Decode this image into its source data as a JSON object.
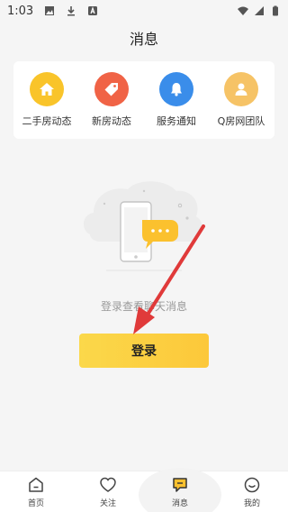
{
  "status_bar": {
    "time": "1:03"
  },
  "header": {
    "title": "消息"
  },
  "categories": [
    {
      "label": "二手房动态",
      "icon": "house-icon",
      "color": "#f9c42a"
    },
    {
      "label": "新房动态",
      "icon": "tag-icon",
      "color": "#f06346"
    },
    {
      "label": "服务通知",
      "icon": "bell-icon",
      "color": "#3a8dea"
    },
    {
      "label": "Q房网团队",
      "icon": "user-icon",
      "color": "#f6c366"
    }
  ],
  "empty": {
    "message": "登录查看聊天消息"
  },
  "login_button": {
    "label": "登录"
  },
  "tabs": [
    {
      "label": "首页",
      "icon": "home-icon"
    },
    {
      "label": "关注",
      "icon": "heart-icon"
    },
    {
      "label": "消息",
      "icon": "message-icon"
    },
    {
      "label": "我的",
      "icon": "smile-icon"
    }
  ],
  "active_tab": "消息"
}
